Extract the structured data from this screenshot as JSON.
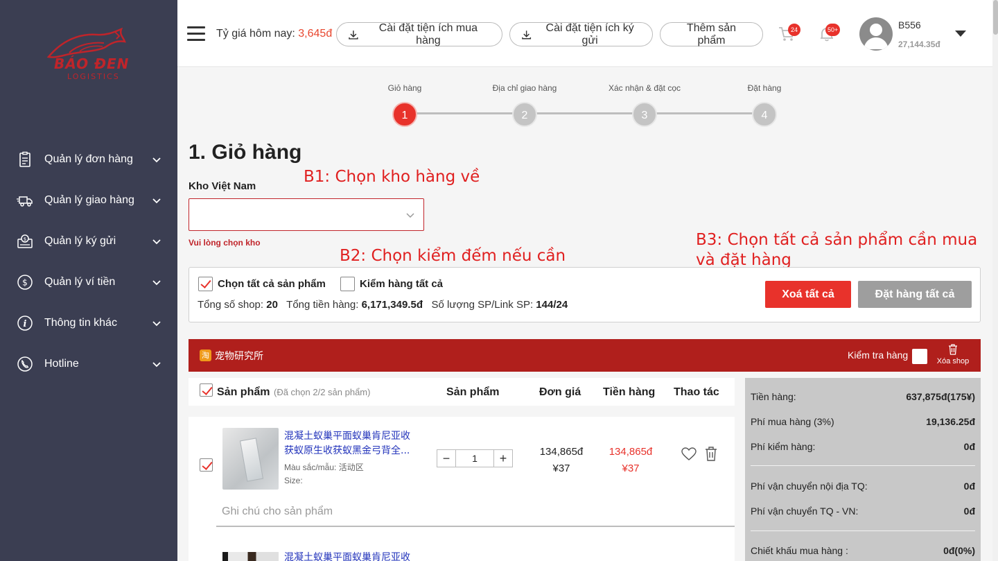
{
  "brand": {
    "logo_text": "BÁO ĐEN",
    "logo_sub": "LOGISTICS",
    "color": "#c0242a"
  },
  "sidebar": {
    "items": [
      {
        "label": "Quản lý đơn hàng",
        "icon": "clipboard-icon"
      },
      {
        "label": "Quản lý giao hàng",
        "icon": "truck-icon"
      },
      {
        "label": "Quản lý ký gửi",
        "icon": "money-box-icon"
      },
      {
        "label": "Quản lý ví tiền",
        "icon": "dollar-circle-icon"
      },
      {
        "label": "Thông tin khác",
        "icon": "info-icon"
      },
      {
        "label": "Hotline",
        "icon": "phone-icon"
      }
    ]
  },
  "header": {
    "rate_label": "Tỷ giá hôm nay:",
    "rate_value": "3,645đ",
    "btn_purchase_ext": "Cài đặt tiện ích mua hàng",
    "btn_consign_ext": "Cài đặt tiện ích ký gửi",
    "btn_add_product": "Thêm sản phẩm",
    "cart_badge": "24",
    "notif_badge": "50+",
    "user_name": "B556",
    "user_balance": "27,144.35đ"
  },
  "stepper": {
    "steps": [
      {
        "label": "Giỏ hàng",
        "num": "1"
      },
      {
        "label": "Địa chỉ giao hàng",
        "num": "2"
      },
      {
        "label": "Xác nhận & đặt cọc",
        "num": "3"
      },
      {
        "label": "Đặt hàng",
        "num": "4"
      }
    ],
    "active": 1
  },
  "page": {
    "title": "1. Giỏ hàng",
    "annot_b1": "B1: Chọn kho hàng về",
    "annot_b2": "B2: Chọn kiểm đếm nếu cần",
    "annot_b3_line1": "B3: Chọn tất cả sản phẩm cần mua",
    "annot_b3_line2": "và đặt hàng",
    "warehouse_label": "Kho Việt Nam",
    "warehouse_value": "",
    "warehouse_error": "Vui lòng chọn kho"
  },
  "summary": {
    "select_all": "Chọn tất cả sản phẩm",
    "check_all": "Kiểm hàng tất cả",
    "shops_label": "Tổng số shop:",
    "shops_value": "20",
    "total_label": "Tổng tiền hàng:",
    "total_value": "6,171,349.5đ",
    "qty_label": "Số lượng SP/Link SP:",
    "qty_value": "144/24",
    "btn_delete_all": "Xoá tất cả",
    "btn_order_all": "Đặt hàng tất cả"
  },
  "shop": {
    "logo": "淘",
    "name": "宠物研究所",
    "check_label": "Kiểm tra hàng",
    "delete_label": "Xóa shop"
  },
  "table": {
    "col_product": "Sản phẩm",
    "selected_note": "(Đã chọn 2/2 sản phẩm)",
    "col_product2": "Sản phẩm",
    "col_unit_price": "Đơn giá",
    "col_amount": "Tiền hàng",
    "col_actions": "Thao tác"
  },
  "products": [
    {
      "title": "混凝土蚁巢平面蚁巢肯尼亚收获蚁原生收获蚁黑金弓背全...",
      "variant": "Màu sắc/mẫu: 活动区",
      "size": "Size:",
      "qty": "1",
      "unit_vnd": "134,865đ",
      "unit_cny": "¥37",
      "amount_vnd": "134,865đ",
      "amount_cny": "¥37",
      "note_placeholder": "Ghi chú cho sản phẩm"
    },
    {
      "title": "混凝土蚁巢平面蚁巢肯尼亚收"
    }
  ],
  "fees": {
    "goods_label": "Tiền hàng:",
    "goods_value": "637,875đ(175¥)",
    "purchase_fee_label": "Phí mua hàng (3%)",
    "purchase_fee_value": "19,136.25đ",
    "check_fee_label": "Phí kiểm hàng:",
    "check_fee_value": "0đ",
    "domestic_ship_label": "Phí vận chuyển nội địa TQ:",
    "domestic_ship_value": "0đ",
    "intl_ship_label": "Phí vận chuyển TQ - VN:",
    "intl_ship_value": "0đ",
    "discount_label": "Chiết khấu mua hàng :",
    "discount_value": "0đ(0%)"
  }
}
